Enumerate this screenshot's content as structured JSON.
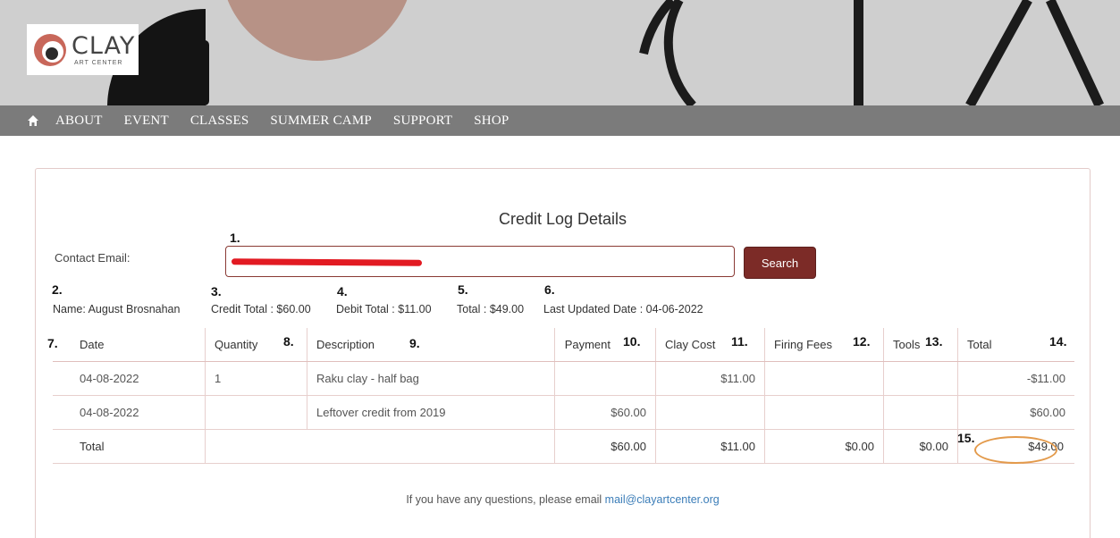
{
  "brand": {
    "name": "CLAY",
    "sub": "ART CENTER"
  },
  "nav": {
    "home_icon": "home-icon",
    "items": [
      "ABOUT",
      "EVENT",
      "CLASSES",
      "SUMMER CAMP",
      "SUPPORT",
      "SHOP"
    ]
  },
  "page": {
    "title": "Credit Log Details",
    "email_label": "Contact Email:",
    "email_value": "",
    "search_label": "Search"
  },
  "summary": {
    "name": "Name: August Brosnahan",
    "credit_total": "Credit Total : $60.00",
    "debit_total": "Debit Total : $11.00",
    "total": "Total : $49.00",
    "last_updated": "Last Updated Date : 04-06-2022"
  },
  "annotations": [
    "1.",
    "2.",
    "3.",
    "4.",
    "5.",
    "6.",
    "7.",
    "8.",
    "9.",
    "10.",
    "11.",
    "12.",
    "13.",
    "14.",
    "15."
  ],
  "table": {
    "headers": [
      "Date",
      "Quantity",
      "Description",
      "Payment",
      "Clay Cost",
      "Firing Fees",
      "Tools",
      "Total"
    ],
    "rows": [
      [
        "04-08-2022",
        "1",
        "Raku clay - half bag",
        "",
        "$11.00",
        "",
        "",
        "-$11.00"
      ],
      [
        "04-08-2022",
        "",
        "Leftover credit from 2019",
        "$60.00",
        "",
        "",
        "",
        "$60.00"
      ]
    ],
    "total_row": [
      "Total",
      "",
      "",
      "$60.00",
      "$11.00",
      "$0.00",
      "$0.00",
      "$49.00"
    ]
  },
  "footer": {
    "text": "If you have any questions, please email ",
    "email": "mail@clayartcenter.org"
  },
  "colors": {
    "brand_dark": "#7c2b27",
    "redaction": "#e21a22",
    "highlight_circle": "#e39a4b",
    "link": "#3b7db8"
  }
}
